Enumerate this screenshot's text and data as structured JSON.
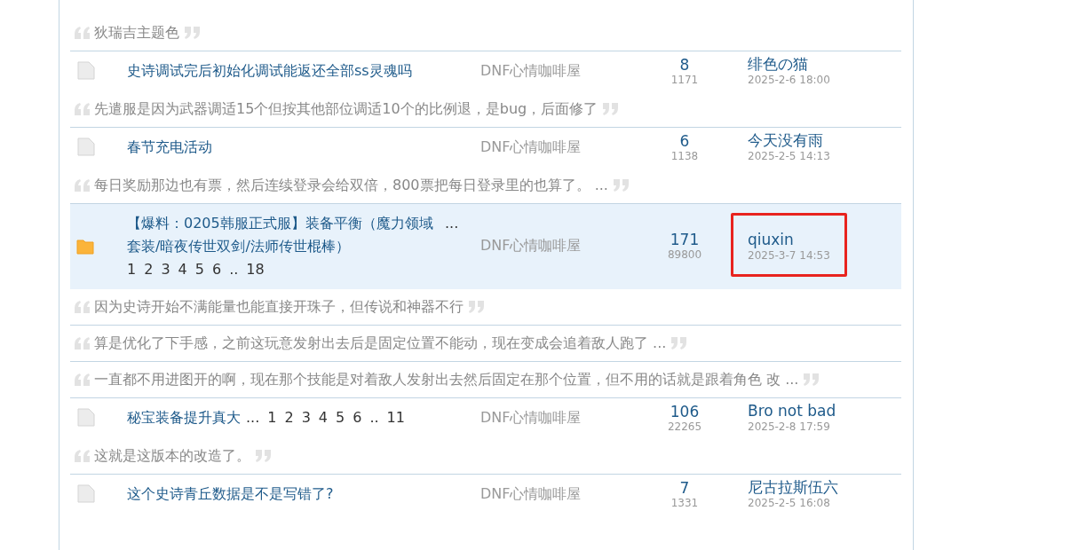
{
  "entries": [
    {
      "kind": "quote",
      "text": "狄瑞吉主题色"
    },
    {
      "kind": "thread",
      "hot": false,
      "title": "史诗调试完后初始化调试能返还全部ss灵魂吗",
      "forum": "DNF心情咖啡屋",
      "replies": "8",
      "views": "1171",
      "author": "绯色の猫",
      "time": "2025-2-6 18:00",
      "marked": false
    },
    {
      "kind": "quote",
      "text": "先遣服是因为武器调适15个但按其他部位调适10个的比例退，是bug，后面修了"
    },
    {
      "kind": "thread",
      "hot": false,
      "title": "春节充电活动",
      "forum": "DNF心情咖啡屋",
      "replies": "6",
      "views": "1138",
      "author": "今天没有雨",
      "time": "2025-2-5 14:13",
      "marked": false
    },
    {
      "kind": "quote",
      "text": "每日奖励那边也有票，然后连续登录会给双倍，800票把每日登录里的也算了。 ..."
    },
    {
      "kind": "thread",
      "hot": true,
      "title": "【爆料：0205韩服正式服】装备平衡（魔力领域套装/暗夜传世双剑/法师传世棍棒）",
      "pages": [
        "...",
        "1",
        "2",
        "3",
        "4",
        "5",
        "6",
        "..",
        "18"
      ],
      "forum": "DNF心情咖啡屋",
      "replies": "171",
      "views": "89800",
      "author": "qiuxin",
      "time": "2025-3-7 14:53",
      "marked": true
    },
    {
      "kind": "quote",
      "text": "因为史诗开始不满能量也能直接开珠子，但传说和神器不行"
    },
    {
      "kind": "quote",
      "text": "算是优化了下手感，之前这玩意发射出去后是固定位置不能动，现在变成会追着敌人跑了 ..."
    },
    {
      "kind": "quote",
      "text": "一直都不用进图开的啊，现在那个技能是对着敌人发射出去然后固定在那个位置，但不用的话就是跟着角色 改 ..."
    },
    {
      "kind": "thread",
      "hot": false,
      "title": "秘宝装备提升真大",
      "pages": [
        "...",
        "1",
        "2",
        "3",
        "4",
        "5",
        "6",
        "..",
        "11"
      ],
      "forum": "DNF心情咖啡屋",
      "replies": "106",
      "views": "22265",
      "author": "Bro not bad",
      "time": "2025-2-8 17:59",
      "marked": false
    },
    {
      "kind": "quote",
      "text": "这就是这版本的改造了。"
    },
    {
      "kind": "thread",
      "hot": false,
      "title": "这个史诗青丘数据是不是写错了?",
      "forum": "DNF心情咖啡屋",
      "replies": "7",
      "views": "1331",
      "author": "尼古拉斯伍六",
      "time": "2025-2-5 16:08",
      "marked": false
    }
  ]
}
